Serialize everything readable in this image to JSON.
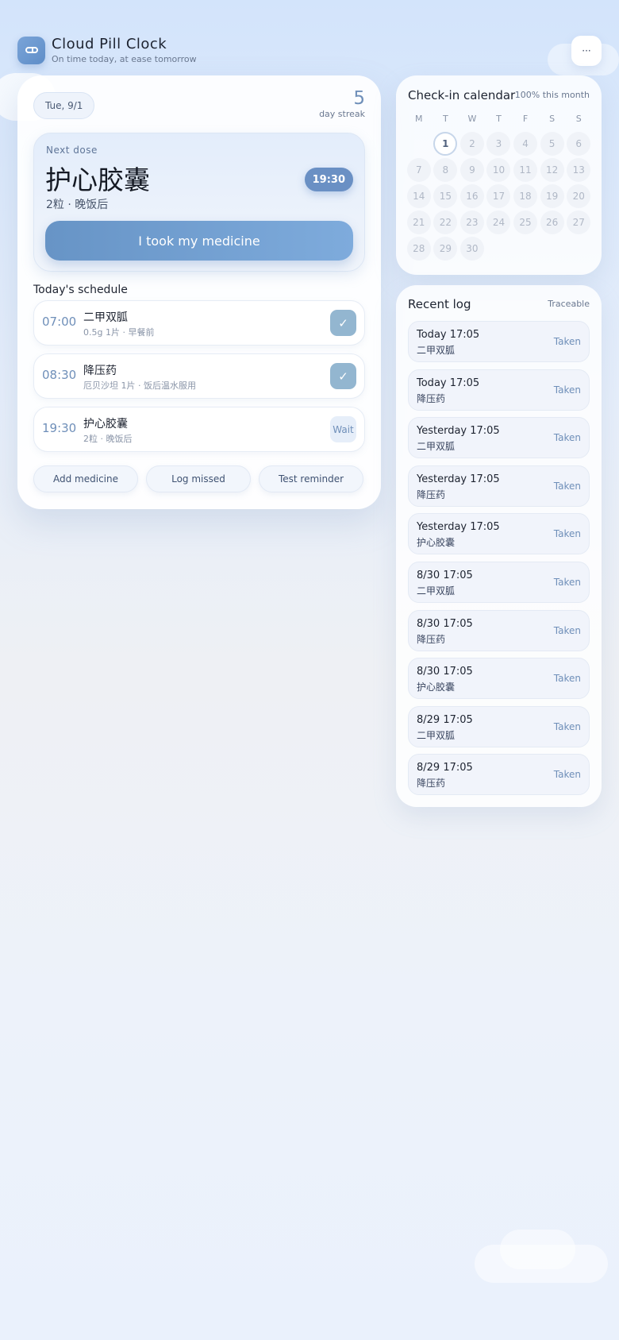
{
  "app": {
    "title": "Cloud Pill Clock",
    "subtitle": "On time today, at ease tomorrow",
    "logo_icon": "pill-icon",
    "more_label": "···"
  },
  "today": {
    "date": "Tue, 9/1",
    "streak_count": "5",
    "streak_label": "day streak"
  },
  "next_dose": {
    "label": "Next dose",
    "name": "护心胶囊",
    "detail": "2粒 · 晚饭后",
    "time": "19:30",
    "action_label": "I took my medicine"
  },
  "schedule": {
    "title": "Today's schedule",
    "items": [
      {
        "time": "07:00",
        "name": "二甲双胍",
        "detail": "0.5g 1片 · 早餐前",
        "status": "✓"
      },
      {
        "time": "08:30",
        "name": "降压药",
        "detail": "厄贝沙坦 1片 · 饭后温水服用",
        "status": "✓"
      },
      {
        "time": "19:30",
        "name": "护心胶囊",
        "detail": "2粒 · 晚饭后",
        "status": "Wait"
      }
    ]
  },
  "actions": {
    "add": "Add medicine",
    "missed": "Log missed",
    "test": "Test reminder"
  },
  "calendar": {
    "title": "Check-in calendar",
    "summary": "100% this month",
    "weekdays": [
      "M",
      "T",
      "W",
      "T",
      "F",
      "S",
      "S"
    ],
    "leading_blanks": 1,
    "days": [
      "1",
      "2",
      "3",
      "4",
      "5",
      "6",
      "7",
      "8",
      "9",
      "10",
      "11",
      "12",
      "13",
      "14",
      "15",
      "16",
      "17",
      "18",
      "19",
      "20",
      "21",
      "22",
      "23",
      "24",
      "25",
      "26",
      "27",
      "28",
      "29",
      "30"
    ],
    "today": "1"
  },
  "log": {
    "title": "Recent log",
    "tag": "Traceable",
    "items": [
      {
        "when": "Today 17:05",
        "med": "二甲双胍",
        "status": "Taken"
      },
      {
        "when": "Today 17:05",
        "med": "降压药",
        "status": "Taken"
      },
      {
        "when": "Yesterday 17:05",
        "med": "二甲双胍",
        "status": "Taken"
      },
      {
        "when": "Yesterday 17:05",
        "med": "降压药",
        "status": "Taken"
      },
      {
        "when": "Yesterday 17:05",
        "med": "护心胶囊",
        "status": "Taken"
      },
      {
        "when": "8/30 17:05",
        "med": "二甲双胍",
        "status": "Taken"
      },
      {
        "when": "8/30 17:05",
        "med": "降压药",
        "status": "Taken"
      },
      {
        "when": "8/30 17:05",
        "med": "护心胶囊",
        "status": "Taken"
      },
      {
        "when": "8/29 17:05",
        "med": "二甲双胍",
        "status": "Taken"
      },
      {
        "when": "8/29 17:05",
        "med": "降压药",
        "status": "Taken"
      }
    ]
  }
}
